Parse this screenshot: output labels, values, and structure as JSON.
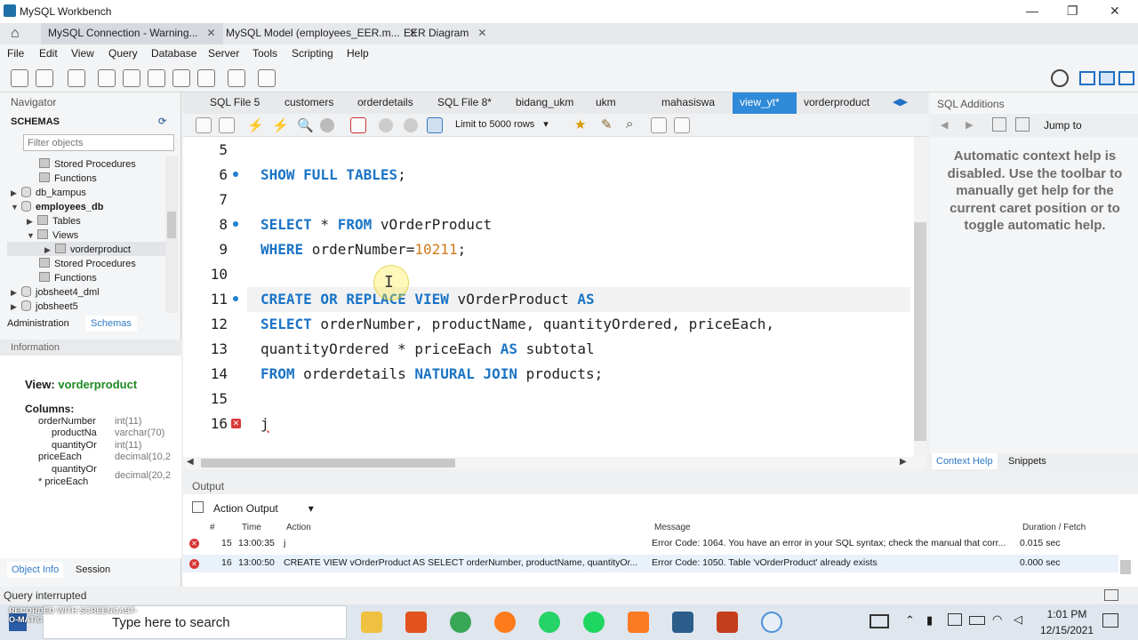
{
  "window": {
    "title": "MySQL Workbench"
  },
  "doc_tabs": [
    "MySQL Connection - Warning...",
    "MySQL Model (employees_EER.m...",
    "EER Diagram"
  ],
  "menu": [
    "File",
    "Edit",
    "View",
    "Query",
    "Database",
    "Server",
    "Tools",
    "Scripting",
    "Help"
  ],
  "navigator": {
    "title": "Navigator",
    "schemas_label": "SCHEMAS",
    "filter_placeholder": "Filter objects",
    "tree": [
      "Stored Procedures",
      "Functions",
      "db_kampus",
      "employees_db",
      "Tables",
      "Views",
      "vorderproduct",
      "Stored Procedures",
      "Functions",
      "jobsheet4_dml",
      "jobsheet5"
    ],
    "tabs": [
      "Administration",
      "Schemas"
    ]
  },
  "information": {
    "title": "Information",
    "view_label": "View:",
    "view_name": "vorderproduct",
    "columns_label": "Columns:",
    "columns": [
      {
        "name": "orderNumber",
        "type": "int(11)"
      },
      {
        "name": "productNa",
        "type": "varchar(70)"
      },
      {
        "name": "quantityOr",
        "type": "int(11)"
      },
      {
        "name": "priceEach",
        "type": "decimal(10,2"
      },
      {
        "name": "quantityOr",
        "type": ""
      },
      {
        "name": "* priceEach",
        "type": "decimal(20,2"
      }
    ],
    "bottom_tabs": [
      "Object Info",
      "Session"
    ]
  },
  "editor_tabs": [
    "SQL File 5",
    "customers",
    "orderdetails",
    "SQL File 8*",
    "bidang_ukm",
    "ukm",
    "mahasiswa",
    "view_yt*",
    "vorderproduct"
  ],
  "editor_toolbar": {
    "limit": "Limit to 5000 rows"
  },
  "code": {
    "line_numbers": [
      "5",
      "6",
      "7",
      "8",
      "9",
      "10",
      "11",
      "12",
      "13",
      "14",
      "15",
      "16"
    ],
    "l6_kw": "SHOW FULL TABLES",
    "l6_rest": ";",
    "l8_kw1": "SELECT",
    "l8_mid": " * ",
    "l8_kw2": "FROM",
    "l8_rest": " vOrderProduct",
    "l9_kw": "WHERE",
    "l9_mid": " orderNumber=",
    "l9_num": "10211",
    "l9_rest": ";",
    "l11_kw": "CREATE OR REPLACE VIEW",
    "l11_mid": " vOrderProduct ",
    "l11_kw2": "AS",
    "l12_kw": "SELECT",
    "l12_rest": " orderNumber, productName, quantityOrdered, priceEach,",
    "l13_a": "quantityOrdered * priceEach ",
    "l13_kw": "AS",
    "l13_b": " subtotal",
    "l14_kw": "FROM",
    "l14_a": " orderdetails ",
    "l14_kw2": "NATURAL JOIN",
    "l14_b": " products;",
    "l16": "j"
  },
  "sql_additions": {
    "title": "SQL Additions",
    "jump_to": "Jump to",
    "help_text": "Automatic context help is disabled. Use the toolbar to manually get help for the current caret position or to toggle automatic help.",
    "tabs": [
      "Context Help",
      "Snippets"
    ]
  },
  "output": {
    "title": "Output",
    "mode": "Action Output",
    "headers": [
      "#",
      "Time",
      "Action",
      "Message",
      "Duration / Fetch"
    ],
    "rows": [
      {
        "num": "15",
        "time": "13:00:35",
        "action": "j",
        "message": "Error Code: 1064. You have an error in your SQL syntax; check the manual that corr...",
        "duration": "0.015 sec"
      },
      {
        "num": "16",
        "time": "13:00:50",
        "action": "CREATE VIEW vOrderProduct AS SELECT orderNumber, productName, quantityOr...",
        "message": "Error Code: 1050. Table 'vOrderProduct' already exists",
        "duration": "0.000 sec"
      }
    ]
  },
  "status": {
    "text": "Query interrupted"
  },
  "taskbar": {
    "search": "Type here to search",
    "watermark": "RECORDED WITH SCREENCAST-O-MATIC",
    "time": "1:01 PM",
    "date": "12/15/2021"
  },
  "colors": {
    "accent": "#2f8ad8",
    "keyword": "#1a74c6",
    "number": "#d07a1a",
    "error": "#d83636",
    "view_name": "#1e8a22"
  }
}
